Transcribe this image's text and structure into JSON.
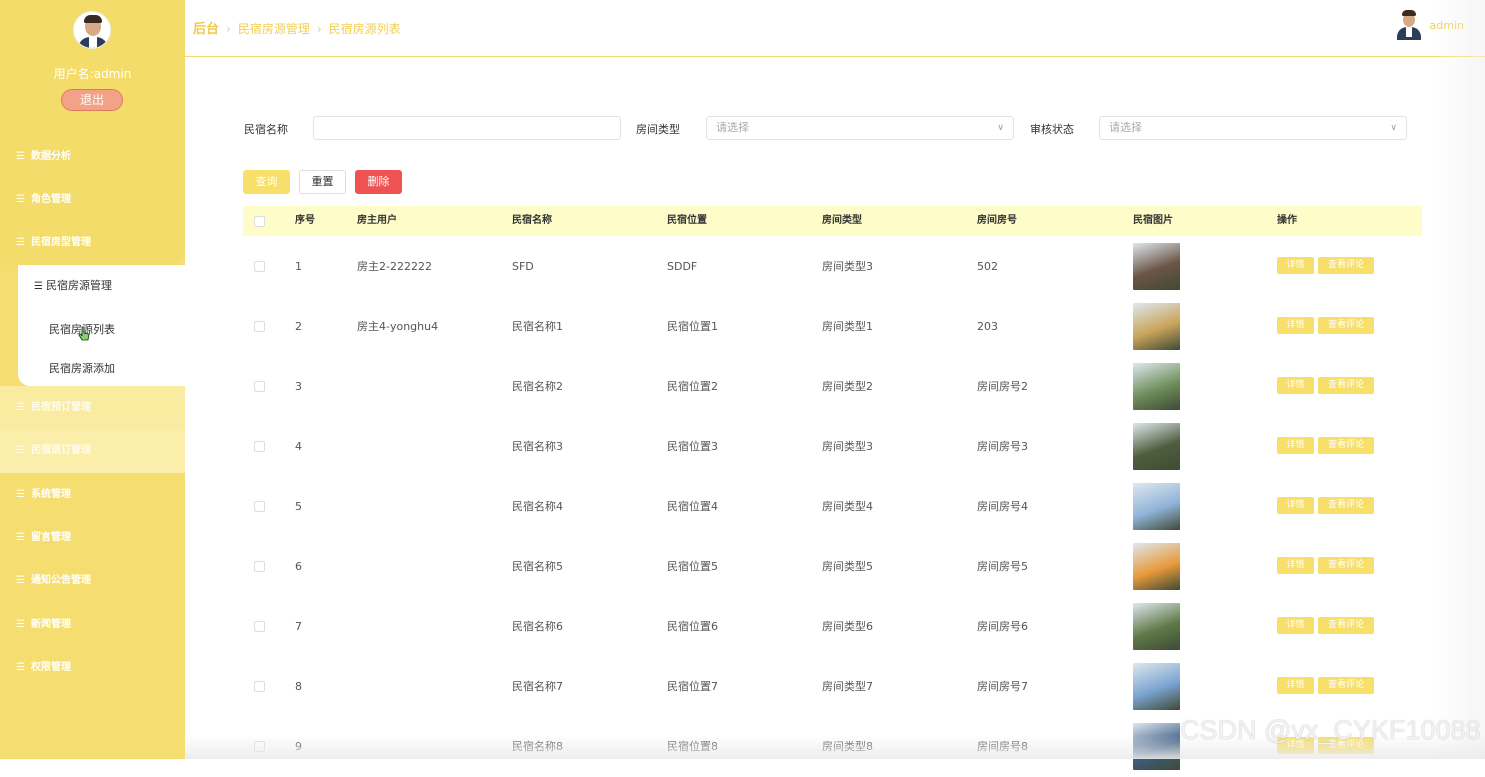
{
  "sidebar": {
    "username": "用户名:admin",
    "logout_label": "退出",
    "menu": [
      {
        "label": "数据分析"
      },
      {
        "label": "角色管理"
      },
      {
        "label": "民宿房型管理"
      },
      {
        "label": "民宿房源管理"
      },
      {
        "label": "民宿预订管理"
      },
      {
        "label": "民宿退订管理"
      },
      {
        "label": "系统管理"
      },
      {
        "label": "留言管理"
      },
      {
        "label": "通知公告管理"
      },
      {
        "label": "新闻管理"
      },
      {
        "label": "权限管理"
      }
    ],
    "submenu": [
      {
        "label": "民宿房源列表"
      },
      {
        "label": "民宿房源添加"
      }
    ]
  },
  "header": {
    "breadcrumb": [
      "后台",
      "民宿房源管理",
      "民宿房源列表"
    ],
    "user_name": "admin"
  },
  "search": {
    "name_label": "民宿名称",
    "name_value": "",
    "type_label": "房间类型",
    "type_placeholder": "请选择",
    "status_label": "审核状态",
    "status_placeholder": "请选择"
  },
  "actions": {
    "query": "查询",
    "reset": "重置",
    "delete": "删除"
  },
  "table": {
    "columns": [
      "序号",
      "房主用户",
      "民宿名称",
      "民宿位置",
      "房间类型",
      "房间房号",
      "民宿图片",
      "操作"
    ],
    "op_detail": "详情",
    "op_review": "查看评论",
    "rows": [
      {
        "no": "1",
        "owner": "房主2-222222",
        "name": "SFD",
        "location": "SDDF",
        "type": "房间类型3",
        "room": "502",
        "img": "#6b5546"
      },
      {
        "no": "2",
        "owner": "房主4-yonghu4",
        "name": "民宿名称1",
        "location": "民宿位置1",
        "type": "房间类型1",
        "room": "203",
        "img": "#c9a45a"
      },
      {
        "no": "3",
        "owner": "",
        "name": "民宿名称2",
        "location": "民宿位置2",
        "type": "房间类型2",
        "room": "房间房号2",
        "img": "#6f8f5c"
      },
      {
        "no": "4",
        "owner": "",
        "name": "民宿名称3",
        "location": "民宿位置3",
        "type": "房间类型3",
        "room": "房间房号3",
        "img": "#4f5e3d"
      },
      {
        "no": "5",
        "owner": "",
        "name": "民宿名称4",
        "location": "民宿位置4",
        "type": "房间类型4",
        "room": "房间房号4",
        "img": "#8fb3d8"
      },
      {
        "no": "6",
        "owner": "",
        "name": "民宿名称5",
        "location": "民宿位置5",
        "type": "房间类型5",
        "room": "房间房号5",
        "img": "#e89a3c"
      },
      {
        "no": "7",
        "owner": "",
        "name": "民宿名称6",
        "location": "民宿位置6",
        "type": "房间类型6",
        "room": "房间房号6",
        "img": "#5f7a48"
      },
      {
        "no": "8",
        "owner": "",
        "name": "民宿名称7",
        "location": "民宿位置7",
        "type": "房间类型7",
        "room": "房间房号7",
        "img": "#7aa3cf"
      },
      {
        "no": "9",
        "owner": "",
        "name": "民宿名称8",
        "location": "民宿位置8",
        "type": "房间类型8",
        "room": "房间房号8",
        "img": "#3e5f86"
      }
    ]
  },
  "watermark": "CSDN @vx_CYKF10088"
}
